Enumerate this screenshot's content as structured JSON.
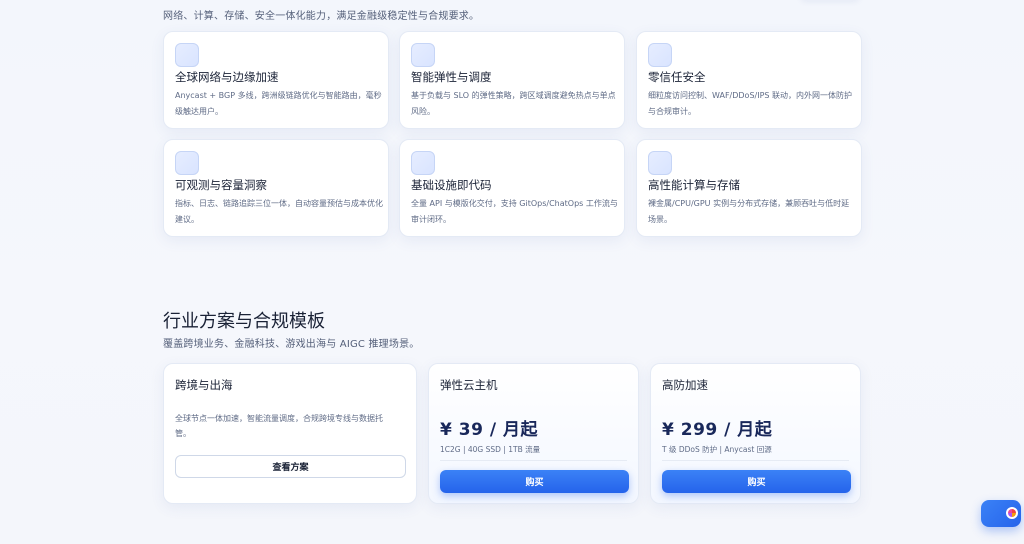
{
  "features": {
    "subtitle": "网络、计算、存储、安全一体化能力，满足金融级稳定性与合规要求。",
    "cards": [
      {
        "icon": "globe-icon",
        "title": "全球网络与边缘加速",
        "desc": "Anycast + BGP 多线，跨洲级链路优化与智能路由，毫秒级触达用户。"
      },
      {
        "icon": "scale-icon",
        "title": "智能弹性与调度",
        "desc": "基于负载与 SLO 的弹性策略，跨区域调度避免热点与单点风险。"
      },
      {
        "icon": "shield-icon",
        "title": "零信任安全",
        "desc": "细粒度访问控制、WAF/DDoS/IPS 联动，内外网一体防护与合规审计。"
      },
      {
        "icon": "chart-icon",
        "title": "可观测与容量洞察",
        "desc": "指标、日志、链路追踪三位一体，自动容量预估与成本优化建议。"
      },
      {
        "icon": "code-icon",
        "title": "基础设施即代码",
        "desc": "全量 API 与模版化交付，支持 GitOps/ChatOps 工作流与审计闭环。"
      },
      {
        "icon": "server-icon",
        "title": "高性能计算与存储",
        "desc": "裸金属/CPU/GPU 实例与分布式存储，兼顾吞吐与低时延场景。"
      }
    ]
  },
  "solutions": {
    "title": "行业方案与合规模板",
    "subtitle": "覆盖跨境业务、金融科技、游戏出海与 AIGC 推理场景。",
    "industry": {
      "title": "跨境与出海",
      "desc": "全球节点一体加速，智能流量调度，合规跨境专线与数据托管。",
      "button": "查看方案"
    },
    "plans": [
      {
        "title": "弹性云主机",
        "price": "¥ 39 / 月起",
        "spec": "1C2G | 40G SSD | 1TB 流量",
        "button": "购买"
      },
      {
        "title": "高防加速",
        "price": "¥ 299 / 月起",
        "spec": "T 级 DDoS 防护 | Anycast 回源",
        "button": "购买"
      }
    ]
  },
  "assistant": {
    "icon": "chat-assistant-icon"
  }
}
